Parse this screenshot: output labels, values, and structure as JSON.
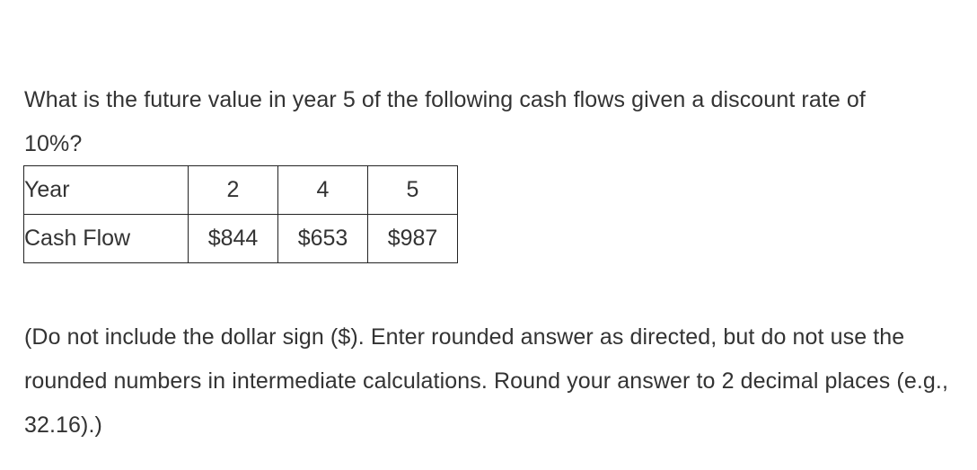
{
  "document": {
    "question": "What is the future value in year 5 of the following cash flows given a discount rate of 10%?",
    "instructions": "(Do not include the dollar sign ($). Enter rounded answer as directed, but do not use the rounded numbers in intermediate calculations. Round your answer to 2 decimal places (e.g., 32.16).)",
    "colors": {
      "text": "#333333",
      "background": "#ffffff",
      "table_border": "#232323",
      "table_border_light": "#c9c9c9"
    }
  },
  "cashflow_table": {
    "rows": [
      {
        "label": "Year",
        "cells": [
          "2",
          "4",
          "5"
        ]
      },
      {
        "label": "Cash Flow",
        "cells": [
          "$844",
          "$653",
          "$987"
        ]
      }
    ]
  }
}
